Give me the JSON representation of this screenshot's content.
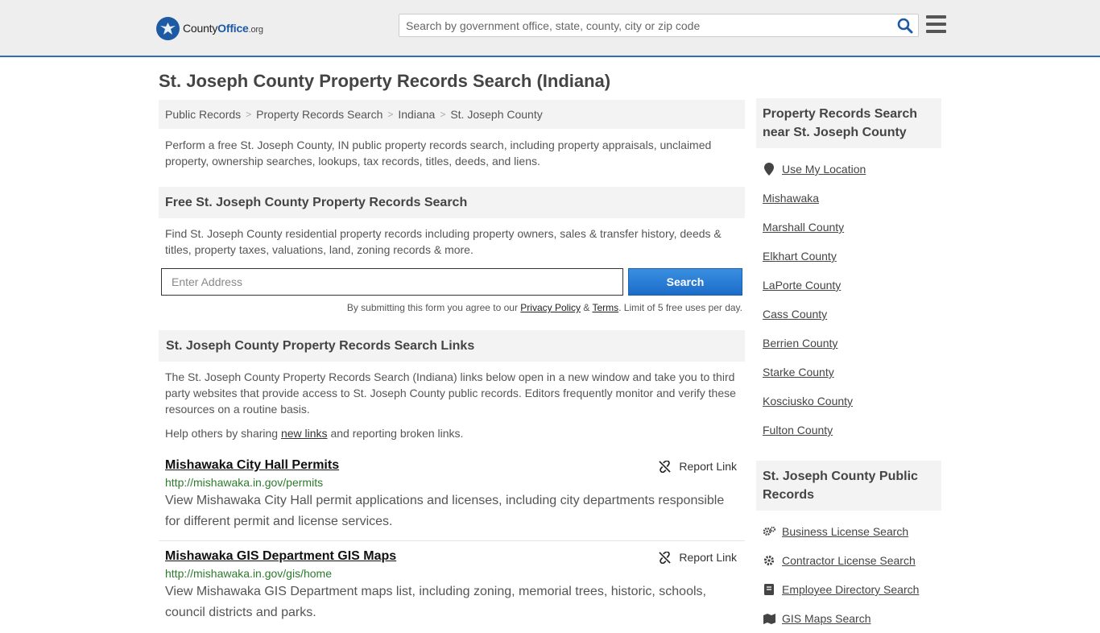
{
  "header": {
    "logo_main": "County",
    "logo_bold": "Office",
    "logo_suffix": ".org",
    "search_placeholder": "Search by government office, state, county, city or zip code"
  },
  "page_title": "St. Joseph County Property Records Search (Indiana)",
  "breadcrumb": [
    "Public Records",
    "Property Records Search",
    "Indiana",
    "St. Joseph County"
  ],
  "intro": "Perform a free St. Joseph County, IN public property records search, including property appraisals, unclaimed property, ownership searches, lookups, tax records, titles, deeds, and liens.",
  "free_search": {
    "heading": "Free St. Joseph County Property Records Search",
    "text": "Find St. Joseph County residential property records including property owners, sales & transfer history, deeds & titles, property taxes, valuations, land, zoning records & more.",
    "address_placeholder": "Enter Address",
    "button": "Search",
    "fine_prefix": "By submitting this form you agree to our",
    "privacy": "Privacy Policy",
    "amp": "&",
    "terms": "Terms",
    "fine_suffix": ". Limit of 5 free uses per day."
  },
  "links_section": {
    "heading": "St. Joseph County Property Records Search Links",
    "text": "The St. Joseph County Property Records Search (Indiana) links below open in a new window and take you to third party websites that provide access to St. Joseph County public records. Editors frequently monitor and verify these resources on a routine basis.",
    "help_prefix": "Help others by sharing",
    "help_link": "new links",
    "help_suffix": "and reporting broken links.",
    "report_label": "Report Link",
    "items": [
      {
        "title": "Mishawaka City Hall Permits",
        "url": "http://mishawaka.in.gov/permits",
        "desc": "View Mishawaka City Hall permit applications and licenses, including city departments responsible for different permit and license services."
      },
      {
        "title": "Mishawaka GIS Department GIS Maps",
        "url": "http://mishawaka.in.gov/gis/home",
        "desc": "View Mishawaka GIS Department maps list, including zoning, memorial trees, historic, schools, council districts and parks."
      }
    ]
  },
  "sidebar": {
    "near_heading": "Property Records Search near St. Joseph County",
    "use_location": "Use My Location",
    "near_items": [
      "Mishawaka",
      "Marshall County",
      "Elkhart County",
      "LaPorte County",
      "Cass County",
      "Berrien County",
      "Starke County",
      "Kosciusko County",
      "Fulton County"
    ],
    "public_heading": "St. Joseph County Public Records",
    "public_items": [
      "Business License Search",
      "Contractor License Search",
      "Employee Directory Search",
      "GIS Maps Search"
    ]
  }
}
